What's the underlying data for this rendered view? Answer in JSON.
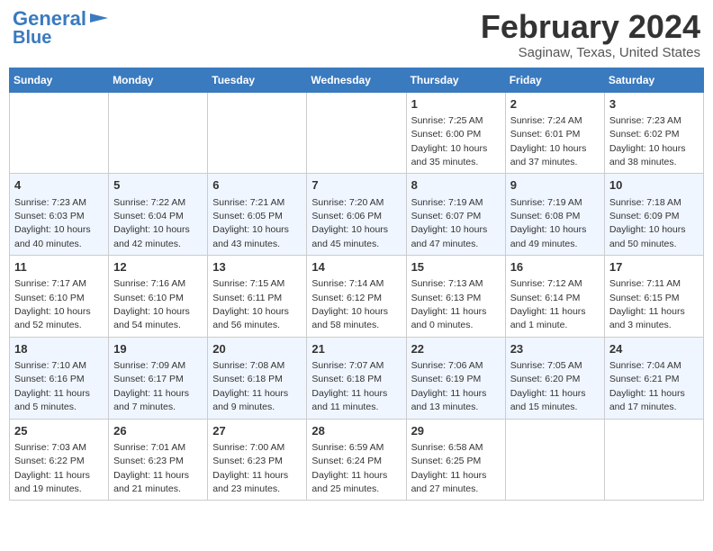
{
  "header": {
    "logo_line1": "General",
    "logo_line2": "Blue",
    "month_title": "February 2024",
    "location": "Saginaw, Texas, United States"
  },
  "weekdays": [
    "Sunday",
    "Monday",
    "Tuesday",
    "Wednesday",
    "Thursday",
    "Friday",
    "Saturday"
  ],
  "weeks": [
    [
      {
        "day": "",
        "sunrise": "",
        "sunset": "",
        "daylight": "",
        "empty": true
      },
      {
        "day": "",
        "sunrise": "",
        "sunset": "",
        "daylight": "",
        "empty": true
      },
      {
        "day": "",
        "sunrise": "",
        "sunset": "",
        "daylight": "",
        "empty": true
      },
      {
        "day": "",
        "sunrise": "",
        "sunset": "",
        "daylight": "",
        "empty": true
      },
      {
        "day": "1",
        "sunrise": "7:25 AM",
        "sunset": "6:00 PM",
        "daylight": "10 hours and 35 minutes."
      },
      {
        "day": "2",
        "sunrise": "7:24 AM",
        "sunset": "6:01 PM",
        "daylight": "10 hours and 37 minutes."
      },
      {
        "day": "3",
        "sunrise": "7:23 AM",
        "sunset": "6:02 PM",
        "daylight": "10 hours and 38 minutes."
      }
    ],
    [
      {
        "day": "4",
        "sunrise": "7:23 AM",
        "sunset": "6:03 PM",
        "daylight": "10 hours and 40 minutes."
      },
      {
        "day": "5",
        "sunrise": "7:22 AM",
        "sunset": "6:04 PM",
        "daylight": "10 hours and 42 minutes."
      },
      {
        "day": "6",
        "sunrise": "7:21 AM",
        "sunset": "6:05 PM",
        "daylight": "10 hours and 43 minutes."
      },
      {
        "day": "7",
        "sunrise": "7:20 AM",
        "sunset": "6:06 PM",
        "daylight": "10 hours and 45 minutes."
      },
      {
        "day": "8",
        "sunrise": "7:19 AM",
        "sunset": "6:07 PM",
        "daylight": "10 hours and 47 minutes."
      },
      {
        "day": "9",
        "sunrise": "7:19 AM",
        "sunset": "6:08 PM",
        "daylight": "10 hours and 49 minutes."
      },
      {
        "day": "10",
        "sunrise": "7:18 AM",
        "sunset": "6:09 PM",
        "daylight": "10 hours and 50 minutes."
      }
    ],
    [
      {
        "day": "11",
        "sunrise": "7:17 AM",
        "sunset": "6:10 PM",
        "daylight": "10 hours and 52 minutes."
      },
      {
        "day": "12",
        "sunrise": "7:16 AM",
        "sunset": "6:10 PM",
        "daylight": "10 hours and 54 minutes."
      },
      {
        "day": "13",
        "sunrise": "7:15 AM",
        "sunset": "6:11 PM",
        "daylight": "10 hours and 56 minutes."
      },
      {
        "day": "14",
        "sunrise": "7:14 AM",
        "sunset": "6:12 PM",
        "daylight": "10 hours and 58 minutes."
      },
      {
        "day": "15",
        "sunrise": "7:13 AM",
        "sunset": "6:13 PM",
        "daylight": "11 hours and 0 minutes."
      },
      {
        "day": "16",
        "sunrise": "7:12 AM",
        "sunset": "6:14 PM",
        "daylight": "11 hours and 1 minute."
      },
      {
        "day": "17",
        "sunrise": "7:11 AM",
        "sunset": "6:15 PM",
        "daylight": "11 hours and 3 minutes."
      }
    ],
    [
      {
        "day": "18",
        "sunrise": "7:10 AM",
        "sunset": "6:16 PM",
        "daylight": "11 hours and 5 minutes."
      },
      {
        "day": "19",
        "sunrise": "7:09 AM",
        "sunset": "6:17 PM",
        "daylight": "11 hours and 7 minutes."
      },
      {
        "day": "20",
        "sunrise": "7:08 AM",
        "sunset": "6:18 PM",
        "daylight": "11 hours and 9 minutes."
      },
      {
        "day": "21",
        "sunrise": "7:07 AM",
        "sunset": "6:18 PM",
        "daylight": "11 hours and 11 minutes."
      },
      {
        "day": "22",
        "sunrise": "7:06 AM",
        "sunset": "6:19 PM",
        "daylight": "11 hours and 13 minutes."
      },
      {
        "day": "23",
        "sunrise": "7:05 AM",
        "sunset": "6:20 PM",
        "daylight": "11 hours and 15 minutes."
      },
      {
        "day": "24",
        "sunrise": "7:04 AM",
        "sunset": "6:21 PM",
        "daylight": "11 hours and 17 minutes."
      }
    ],
    [
      {
        "day": "25",
        "sunrise": "7:03 AM",
        "sunset": "6:22 PM",
        "daylight": "11 hours and 19 minutes."
      },
      {
        "day": "26",
        "sunrise": "7:01 AM",
        "sunset": "6:23 PM",
        "daylight": "11 hours and 21 minutes."
      },
      {
        "day": "27",
        "sunrise": "7:00 AM",
        "sunset": "6:23 PM",
        "daylight": "11 hours and 23 minutes."
      },
      {
        "day": "28",
        "sunrise": "6:59 AM",
        "sunset": "6:24 PM",
        "daylight": "11 hours and 25 minutes."
      },
      {
        "day": "29",
        "sunrise": "6:58 AM",
        "sunset": "6:25 PM",
        "daylight": "11 hours and 27 minutes."
      },
      {
        "day": "",
        "sunrise": "",
        "sunset": "",
        "daylight": "",
        "empty": true
      },
      {
        "day": "",
        "sunrise": "",
        "sunset": "",
        "daylight": "",
        "empty": true
      }
    ]
  ]
}
